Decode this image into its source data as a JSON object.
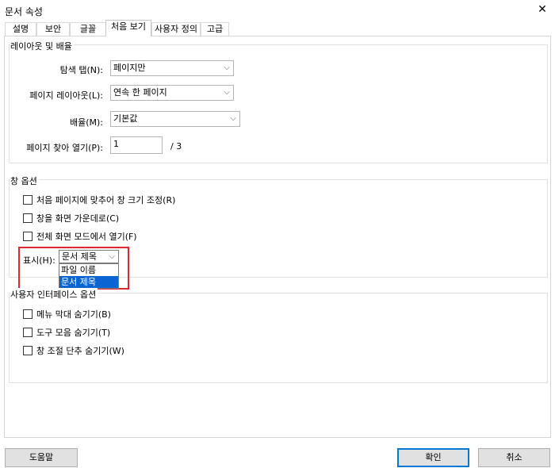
{
  "window": {
    "title": "문서 속성",
    "close_icon": "close-icon"
  },
  "tabs": [
    {
      "label": "설명"
    },
    {
      "label": "보안"
    },
    {
      "label": "글꼴"
    },
    {
      "label": "처음 보기"
    },
    {
      "label": "사용자 정의"
    },
    {
      "label": "고급"
    }
  ],
  "active_tab": "처음 보기",
  "layout_group": {
    "title": "레이아웃 및 배율",
    "nav_tab_label": "탐색 탭(N):",
    "nav_tab_value": "페이지만",
    "page_layout_label": "페이지 레이아웃(L):",
    "page_layout_value": "연속 한 페이지",
    "magnification_label": "배율(M):",
    "magnification_value": "기본값",
    "open_page_label": "페이지 찾아 열기(P):",
    "open_page_value": "1",
    "page_total": "/ 3"
  },
  "window_group": {
    "title": "창 옵션",
    "options": [
      {
        "label": "처음 페이지에 맞추어 창 크기 조정(R)",
        "checked": false
      },
      {
        "label": "창을 화면 가운데로(C)",
        "checked": false
      },
      {
        "label": "전체 화면 모드에서 열기(F)",
        "checked": false
      }
    ],
    "show_label": "표시(H):",
    "show_value": "문서 제목",
    "show_options": [
      {
        "label": "파일 이름",
        "selected": false
      },
      {
        "label": "문서 제목",
        "selected": true
      }
    ]
  },
  "ui_group": {
    "title": "사용자 인터페이스 옵션",
    "options": [
      {
        "label": "메뉴 막대 숨기기(B)",
        "checked": false
      },
      {
        "label": "도구 모음 숨기기(T)",
        "checked": false
      },
      {
        "label": "창 조절 단추 숨기기(W)",
        "checked": false
      }
    ]
  },
  "buttons": {
    "help": "도움말",
    "ok": "확인",
    "cancel": "취소"
  },
  "colors": {
    "highlight": "#e0282c",
    "selection": "#0a64d2",
    "default_button_border": "#0078d7"
  }
}
